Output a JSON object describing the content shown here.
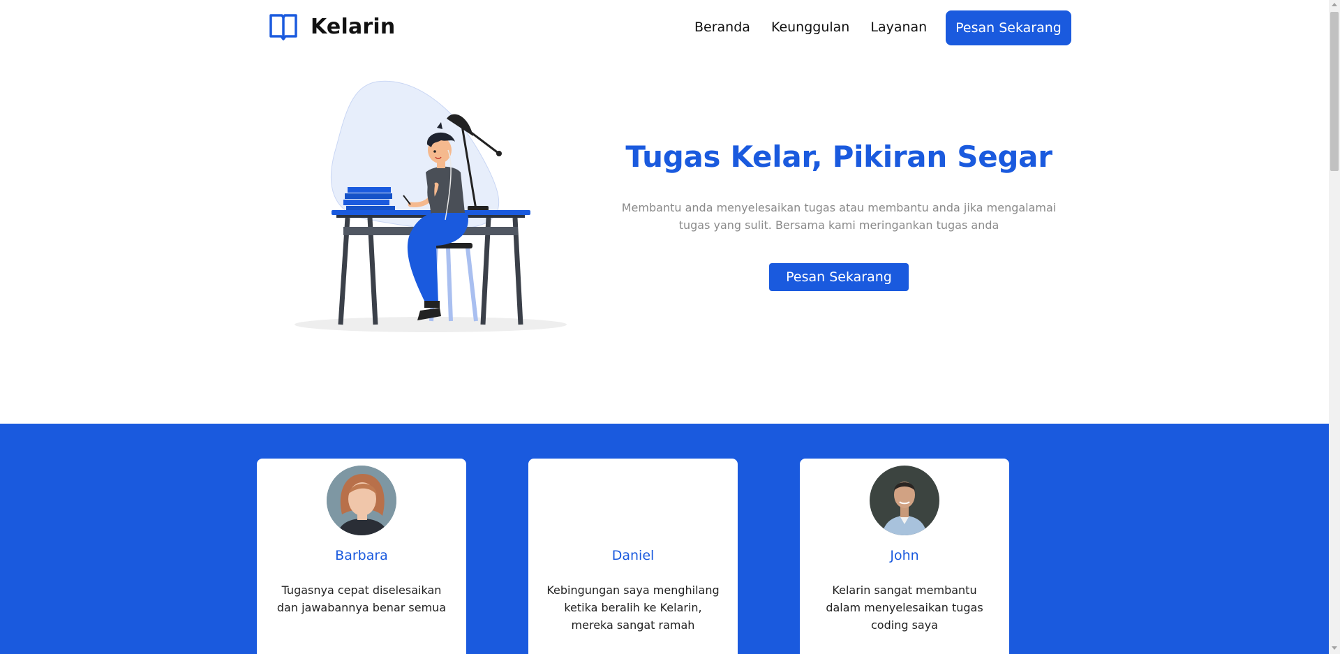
{
  "brand": {
    "name": "Kelarin",
    "icon": "open-book-icon",
    "color": "#1a5ade"
  },
  "nav": {
    "links": [
      "Beranda",
      "Keunggulan",
      "Layanan"
    ],
    "cta": "Pesan Sekarang"
  },
  "hero": {
    "illustration": "person-studying-at-desk-illustration",
    "title": "Tugas Kelar, Pikiran Segar",
    "description": "Membantu anda menyelesaikan tugas atau membantu anda jika mengalamai tugas yang sulit. Bersama kami meringankan tugas anda",
    "cta": "Pesan Sekarang"
  },
  "testimonials": [
    {
      "name": "Barbara",
      "text": "Tugasnya cepat diselesaikan dan jawabannya benar semua",
      "avatar": "woman-photo"
    },
    {
      "name": "Daniel",
      "text": "Kebingungan saya menghilang ketika beralih ke Kelarin, mereka sangat ramah",
      "avatar": ""
    },
    {
      "name": "John",
      "text": "Kelarin sangat membantu dalam menyelesaikan tugas coding saya",
      "avatar": "man-photo"
    }
  ],
  "colors": {
    "accent": "#1a5ade",
    "muted_text": "#8a8a8a",
    "section_bg": "#1a5ade"
  }
}
